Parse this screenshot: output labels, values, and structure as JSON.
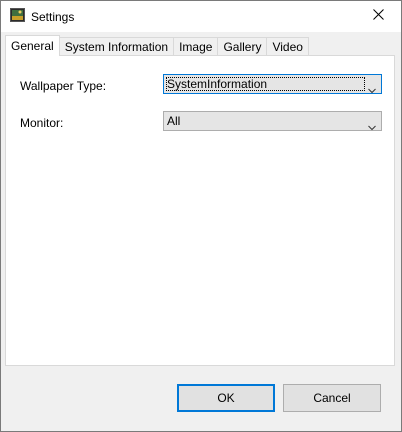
{
  "window": {
    "title": "Settings"
  },
  "tabs": [
    {
      "label": "General",
      "active": true
    },
    {
      "label": "System Information",
      "active": false
    },
    {
      "label": "Image",
      "active": false
    },
    {
      "label": "Gallery",
      "active": false
    },
    {
      "label": "Video",
      "active": false
    }
  ],
  "general": {
    "wallpaper_type": {
      "label": "Wallpaper Type:",
      "value": "SystemInformation"
    },
    "monitor": {
      "label": "Monitor:",
      "value": "All"
    }
  },
  "buttons": {
    "ok_label": "OK",
    "cancel_label": "Cancel"
  },
  "icons": {
    "app": "settings-app-icon",
    "close": "close-icon",
    "dropdown": "chevron-down-icon"
  },
  "colors": {
    "focus_accent": "#0078d7",
    "dialog_background": "#f0f0f0",
    "panel_background": "#ffffff"
  }
}
